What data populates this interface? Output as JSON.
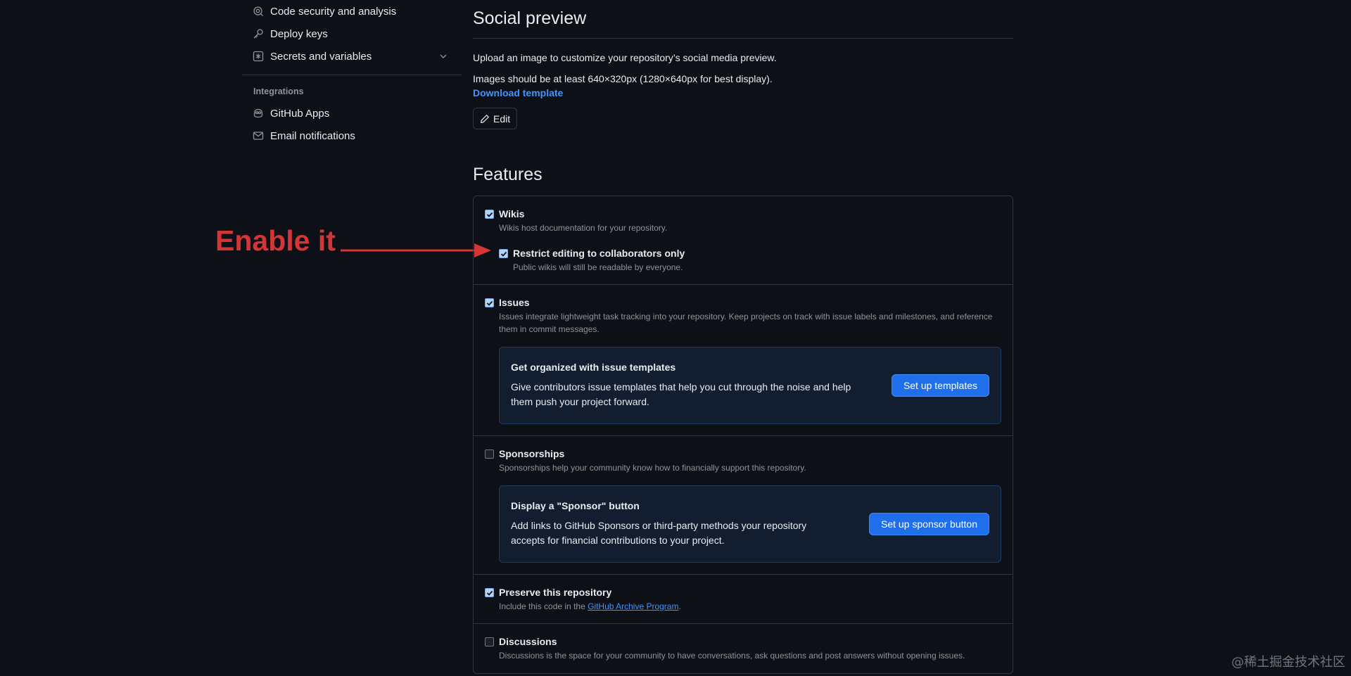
{
  "sidebar": {
    "items_top": [
      {
        "label": "Code security and analysis",
        "icon": "codescan-icon"
      },
      {
        "label": "Deploy keys",
        "icon": "key-icon"
      },
      {
        "label": "Secrets and variables",
        "icon": "asterisk-icon",
        "expandable": true
      }
    ],
    "integrations_heading": "Integrations",
    "items_integrations": [
      {
        "label": "GitHub Apps",
        "icon": "copilot-icon"
      },
      {
        "label": "Email notifications",
        "icon": "mail-icon"
      }
    ]
  },
  "annotation": {
    "text": "Enable it",
    "color": "#d63536"
  },
  "social_preview": {
    "title": "Social preview",
    "description": "Upload an image to customize your repository’s social media preview.",
    "size_hint": "Images should be at least 640×320px (1280×640px for best display).",
    "download_link": "Download template",
    "edit_label": "Edit"
  },
  "features": {
    "title": "Features",
    "wikis": {
      "label": "Wikis",
      "checked": true,
      "description": "Wikis host documentation for your repository.",
      "restrict": {
        "label": "Restrict editing to collaborators only",
        "checked": true,
        "description": "Public wikis will still be readable by everyone."
      }
    },
    "issues": {
      "label": "Issues",
      "checked": true,
      "description": "Issues integrate lightweight task tracking into your repository. Keep projects on track with issue labels and milestones, and reference them in commit messages.",
      "callout": {
        "title": "Get organized with issue templates",
        "text": "Give contributors issue templates that help you cut through the noise and help them push your project forward.",
        "button": "Set up templates"
      }
    },
    "sponsorships": {
      "label": "Sponsorships",
      "checked": false,
      "description": "Sponsorships help your community know how to financially support this repository.",
      "callout": {
        "title": "Display a \"Sponsor\" button",
        "text": "Add links to GitHub Sponsors or third-party methods your repository accepts for financial contributions to your project.",
        "button": "Set up sponsor button"
      }
    },
    "preserve": {
      "label": "Preserve this repository",
      "checked": true,
      "description_prefix": "Include this code in the ",
      "description_link": "GitHub Archive Program",
      "description_suffix": "."
    },
    "discussions": {
      "label": "Discussions",
      "checked": false,
      "description": "Discussions is the space for your community to have conversations, ask questions and post answers without opening issues."
    }
  },
  "watermark": "@稀土掘金技术社区",
  "colors": {
    "background": "#0d1117",
    "accent": "#1f6feb",
    "link": "#4493f8",
    "border": "#30363d"
  }
}
